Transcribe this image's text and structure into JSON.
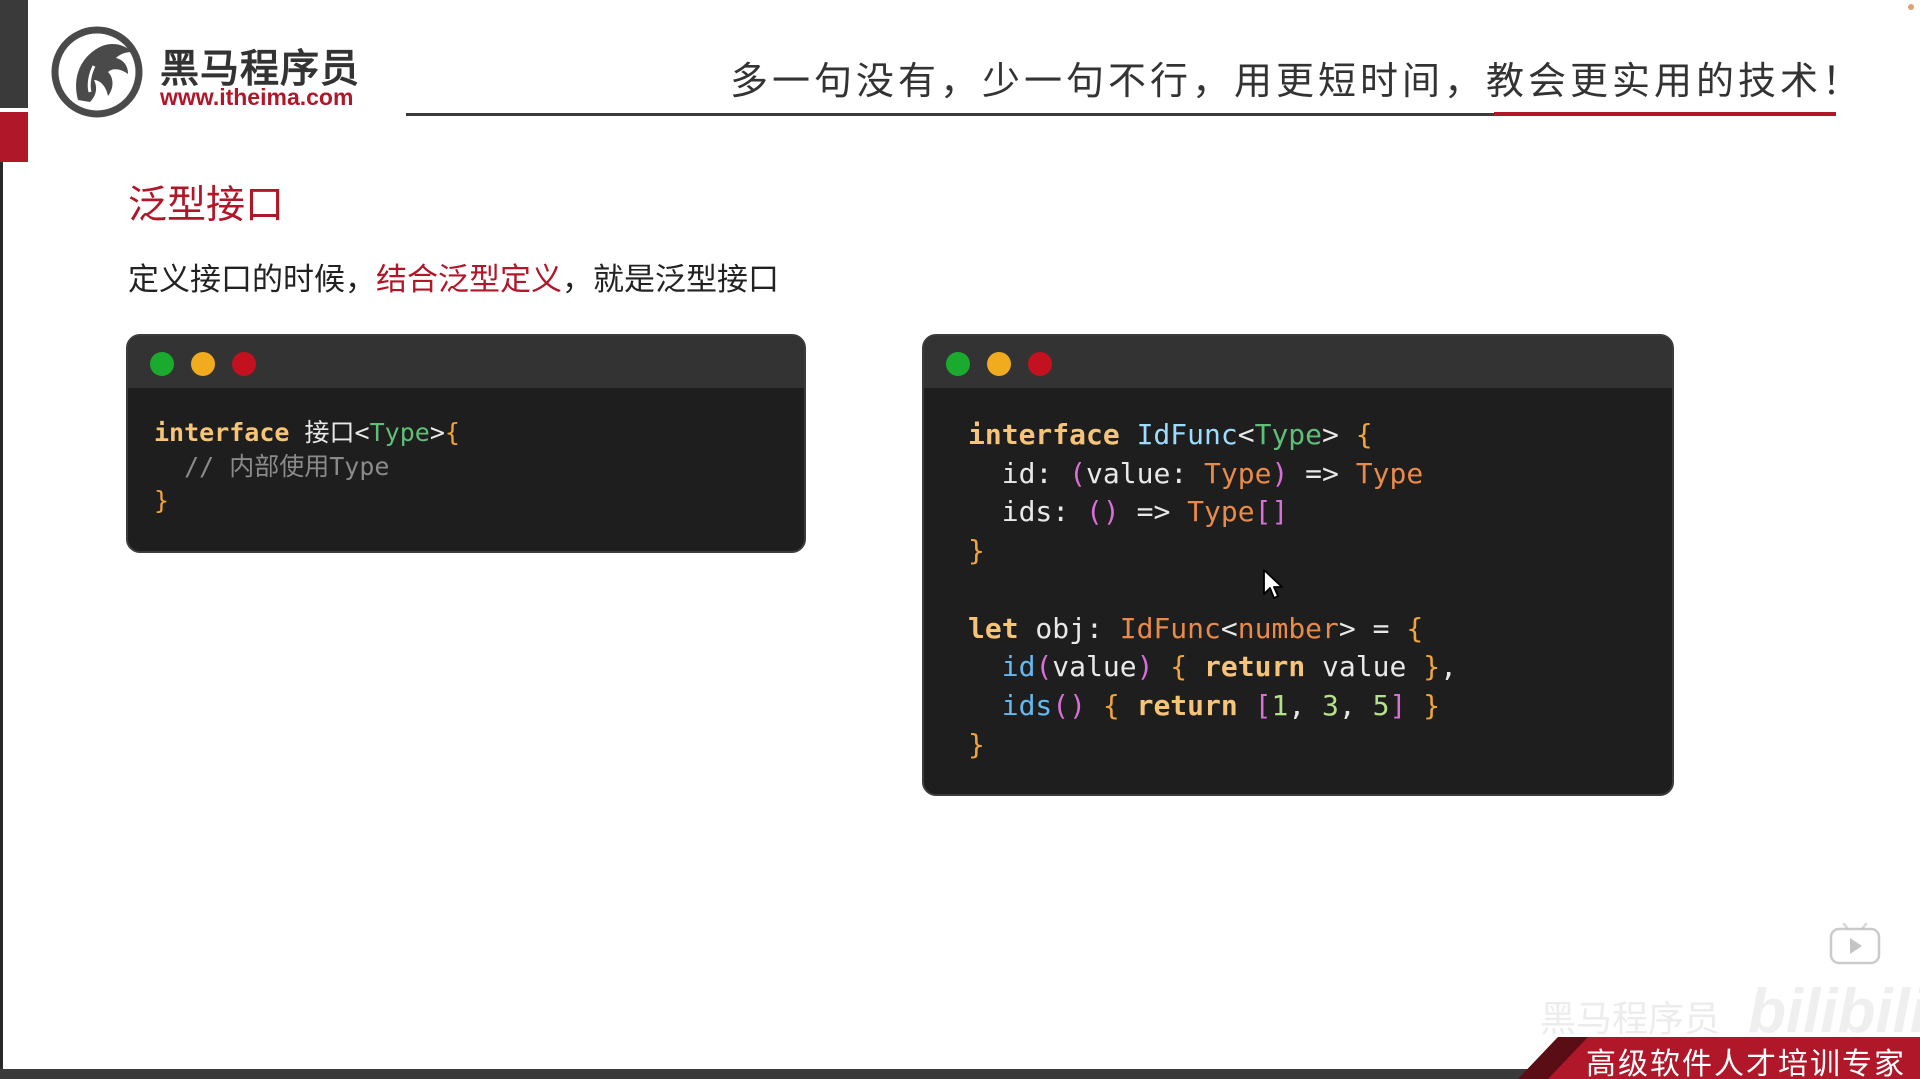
{
  "header": {
    "logo_cn": "黑马程序员",
    "logo_url": "www.itheima.com",
    "slogan": "多一句没有，少一句不行，用更短时间，教会更实用的技术！"
  },
  "slide": {
    "title": "泛型接口",
    "lead_prefix": "定义接口的时候，",
    "lead_highlight": "结合泛型定义",
    "lead_suffix": "，就是泛型接口"
  },
  "code_left": {
    "l1_kw": "interface",
    "l1_name": " 接口",
    "l1_lt": "<",
    "l1_type": "Type",
    "l1_gt": ">",
    "l1_brace": "{",
    "l2_comment": "  // 内部使用Type",
    "l3_brace": "}"
  },
  "code_right": {
    "l1_kw": "interface",
    "l1_name": " IdFunc",
    "l1_lt": "<",
    "l1_type": "Type",
    "l1_gt": ">",
    "l1_brace": " {",
    "l2_indent": "  ",
    "l2_prop": "id",
    "l2_colon": ": ",
    "l2_paren_open": "(",
    "l2_param": "value",
    "l2_colon2": ": ",
    "l2_type": "Type",
    "l2_paren_close": ")",
    "l2_arrow": " => ",
    "l2_ret": "Type",
    "l3_indent": "  ",
    "l3_prop": "ids",
    "l3_colon": ": ",
    "l3_parens": "()",
    "l3_arrow": " => ",
    "l3_ret": "Type",
    "l3_brackets": "[]",
    "l4_brace": "}",
    "l6_kw": "let",
    "l6_var": " obj",
    "l6_colon": ": ",
    "l6_type": "IdFunc",
    "l6_lt": "<",
    "l6_arg": "number",
    "l6_gt": ">",
    "l6_eq": " = ",
    "l6_brace": "{",
    "l7_indent": "  ",
    "l7_fn": "id",
    "l7_po": "(",
    "l7_param": "value",
    "l7_pc": ")",
    "l7_bo": " { ",
    "l7_ret": "return",
    "l7_val": " value ",
    "l7_bc": "}",
    "l7_comma": ",",
    "l8_indent": "  ",
    "l8_fn": "ids",
    "l8_parens": "()",
    "l8_bo": " { ",
    "l8_ret": "return",
    "l8_sp": " ",
    "l8_lb": "[",
    "l8_n1": "1",
    "l8_c1": ", ",
    "l8_n2": "3",
    "l8_c2": ", ",
    "l8_n3": "5",
    "l8_rb": "]",
    "l8_bc": " }",
    "l9_brace": "}"
  },
  "watermark": {
    "channel": "黑马程序员",
    "site": "bilibili"
  },
  "footer": {
    "tag": "高级软件人才培训专家"
  },
  "colors": {
    "brand_red": "#b0182a",
    "code_bg": "#1e1e1e",
    "dot_green": "#1aab2e",
    "dot_yellow": "#f0ac1e",
    "dot_red": "#c3111f"
  },
  "icons": [
    "logo-horse-icon",
    "mouse-cursor-icon",
    "play-icon"
  ]
}
